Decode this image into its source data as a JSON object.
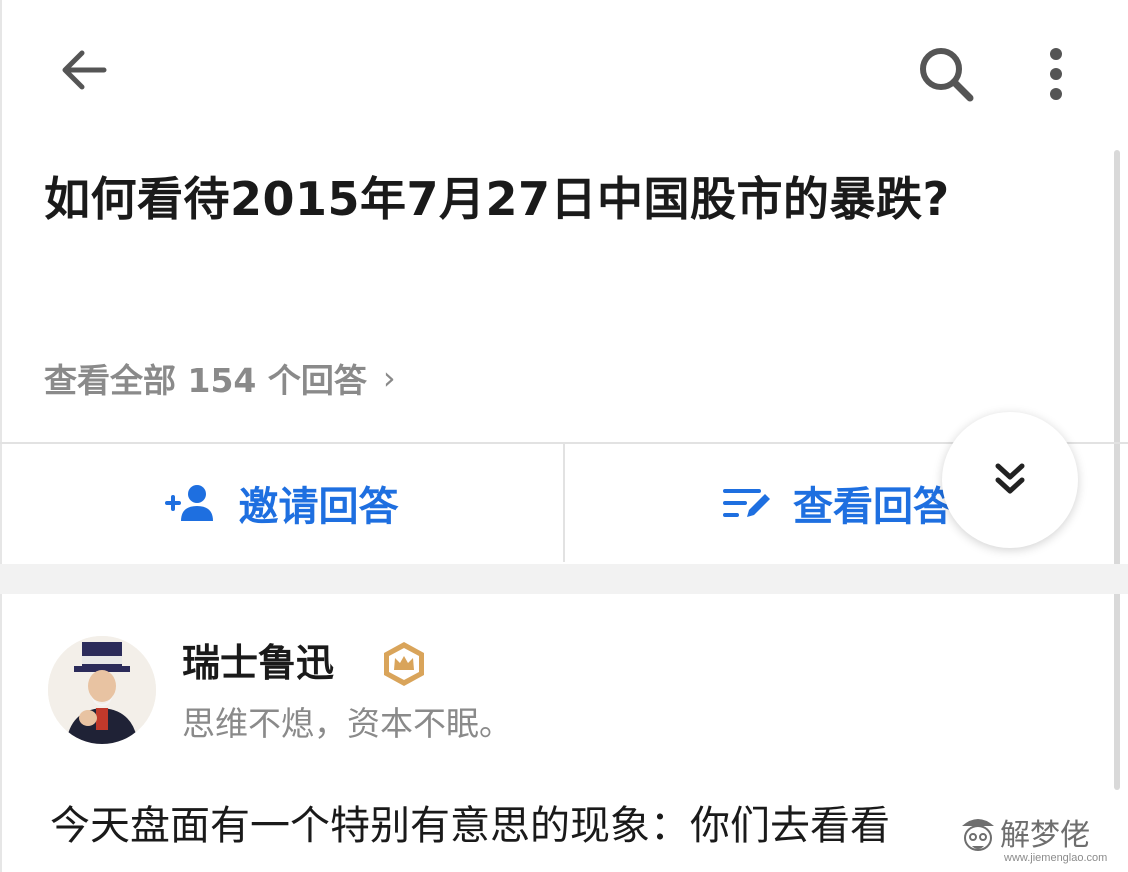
{
  "question": {
    "title": "如何看待2015年7月27日中国股市的暴跌?",
    "view_all_label": "查看全部 154 个回答"
  },
  "actions": {
    "invite_label": "邀请回答",
    "view_label": "查看回答"
  },
  "answer": {
    "author_name": "瑞士鲁迅",
    "author_bio": "思维不熄，资本不眠。",
    "content_preview": "今天盘面有一个特别有意思的现象：你们去看看"
  },
  "watermark": {
    "text": "解梦佬",
    "url": "www.jiemenglao.com"
  },
  "icons": {
    "back": "arrow-left-icon",
    "search": "search-icon",
    "more": "more-vertical-icon",
    "invite": "add-person-icon",
    "write": "write-icon",
    "expand": "double-chevron-down-icon",
    "badge": "crown-badge-icon"
  },
  "colors": {
    "accent": "#1e6fe0",
    "muted_text": "#8a8a8a",
    "badge_gold": "#d9a45a"
  }
}
